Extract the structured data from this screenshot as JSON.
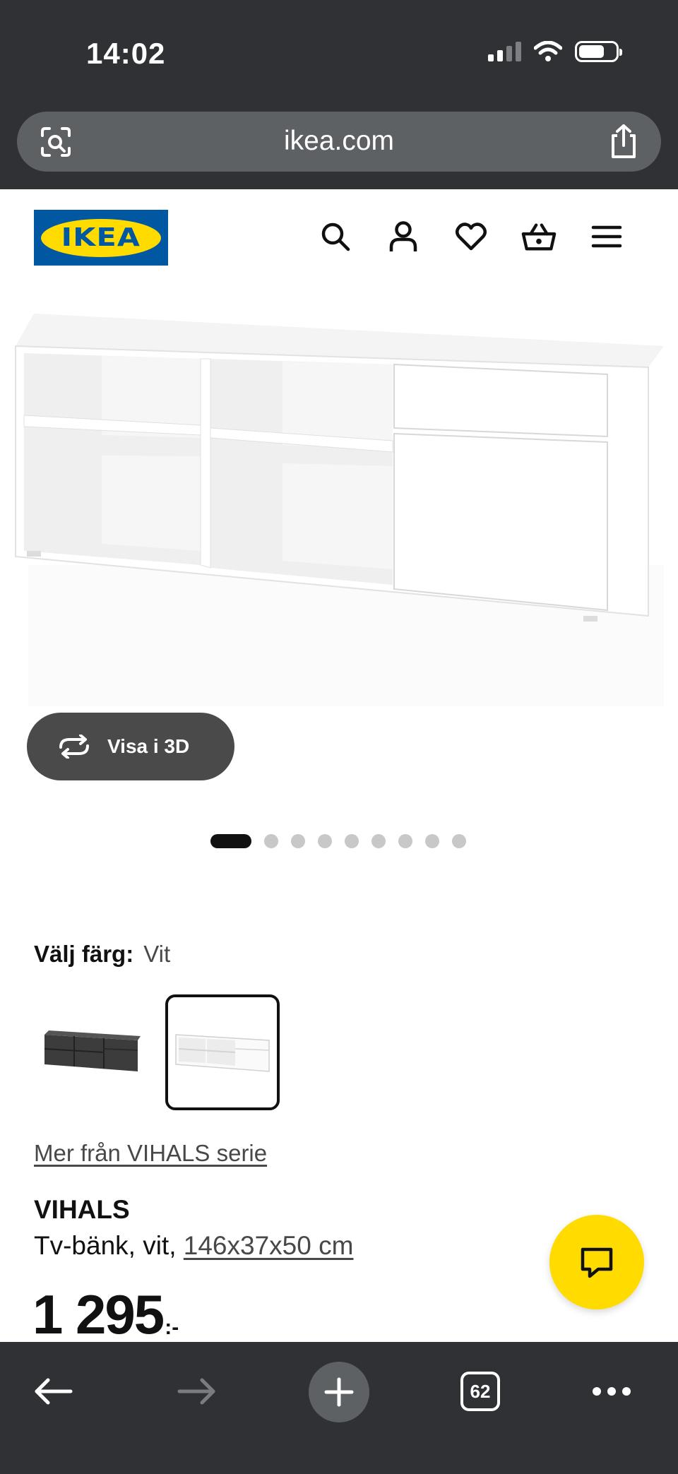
{
  "status_bar": {
    "time": "14:02"
  },
  "browser": {
    "url": "ikea.com",
    "tabs_count": "62"
  },
  "header": {
    "logo_text": "IKEA",
    "icons": [
      "search-icon",
      "account-icon",
      "heart-icon",
      "basket-icon",
      "menu-icon"
    ]
  },
  "product_gallery": {
    "view_3d_label": "Visa i 3D",
    "image_count": 9,
    "active_image": 1
  },
  "color": {
    "label": "Välj färg:",
    "value": "Vit",
    "options": [
      "dark-grey",
      "white"
    ],
    "selected_index": 1
  },
  "series_link": "Mer från VIHALS serie",
  "product": {
    "name": "VIHALS",
    "description_prefix": "Tv-bänk, vit,",
    "dimensions": "146x37x50 cm",
    "price": "1 295",
    "price_suffix": ":-"
  },
  "colors": {
    "ikea_blue": "#0058a3",
    "ikea_yellow": "#ffdb00",
    "chrome": "#2f3134"
  }
}
